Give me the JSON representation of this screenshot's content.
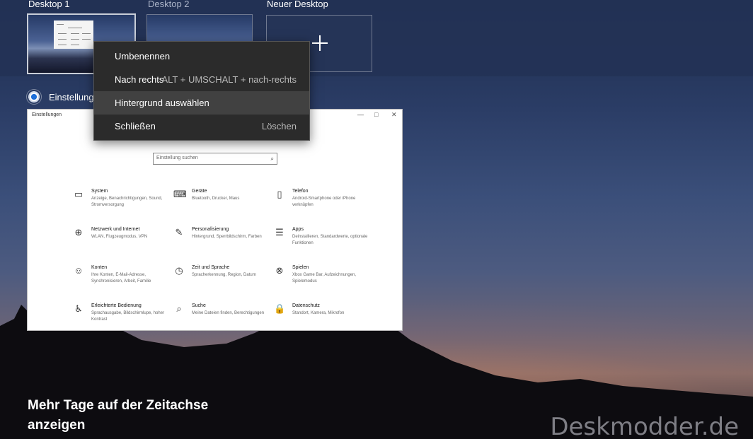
{
  "desktops": [
    {
      "label": "Desktop 1"
    },
    {
      "label": "Desktop 2"
    }
  ],
  "new_desktop_label": "Neuer Desktop",
  "app_window": {
    "title_label": "Einstellungen",
    "window_title": "Einstellungen",
    "search_placeholder": "Einstellung suchen",
    "tiles": [
      {
        "icon": "laptop-icon",
        "glyph": "▭",
        "title": "System",
        "desc": "Anzeige, Benachrichtigungen, Sound, Stromversorgung"
      },
      {
        "icon": "devices-icon",
        "glyph": "⌨",
        "title": "Geräte",
        "desc": "Bluetooth, Drucker, Maus"
      },
      {
        "icon": "phone-icon",
        "glyph": "▯",
        "title": "Telefon",
        "desc": "Android-Smartphone oder iPhone verknüpfen"
      },
      {
        "icon": "globe-icon",
        "glyph": "⊕",
        "title": "Netzwerk und Internet",
        "desc": "WLAN, Flugzeugmodus, VPN"
      },
      {
        "icon": "brush-icon",
        "glyph": "✎",
        "title": "Personalisierung",
        "desc": "Hintergrund, Sperrbildschirm, Farben"
      },
      {
        "icon": "apps-icon",
        "glyph": "☰",
        "title": "Apps",
        "desc": "Deinstallieren, Standardwerte, optionale Funktionen"
      },
      {
        "icon": "person-icon",
        "glyph": "☺",
        "title": "Konten",
        "desc": "Ihre Konten, E-Mail-Adresse, Synchronisieren, Arbeit, Familie"
      },
      {
        "icon": "time-language-icon",
        "glyph": "◷",
        "title": "Zeit und Sprache",
        "desc": "Spracherkennung, Region, Datum"
      },
      {
        "icon": "xbox-icon",
        "glyph": "⊗",
        "title": "Spielen",
        "desc": "Xbox Game Bar, Aufzeichnungen, Spielemodus"
      },
      {
        "icon": "accessibility-icon",
        "glyph": "♿",
        "title": "Erleichterte Bedienung",
        "desc": "Sprachausgabe, Bildschirmlupe, hoher Kontrast"
      },
      {
        "icon": "search-icon",
        "glyph": "⌕",
        "title": "Suche",
        "desc": "Meine Dateien finden, Berechtigungen"
      },
      {
        "icon": "lock-icon",
        "glyph": "🔒",
        "title": "Datenschutz",
        "desc": "Standort, Kamera, Mikrofon"
      }
    ]
  },
  "context_menu": {
    "items": [
      {
        "label": "Umbenennen",
        "shortcut": ""
      },
      {
        "label": "Nach rechts",
        "shortcut": "ALT + UMSCHALT + nach-rechts"
      },
      {
        "label": "Hintergrund auswählen",
        "shortcut": ""
      },
      {
        "label": "Schließen",
        "shortcut": "Löschen"
      }
    ],
    "highlighted_index": 2
  },
  "timeline_link": {
    "line1": "Mehr Tage auf der Zeitachse",
    "line2": "anzeigen"
  },
  "watermark": "Deskmodder.de",
  "colors": {
    "topbar": "#233255",
    "menu_bg": "#2b2b2b",
    "menu_highlight": "#414141",
    "accent": "#1e6fd9"
  }
}
